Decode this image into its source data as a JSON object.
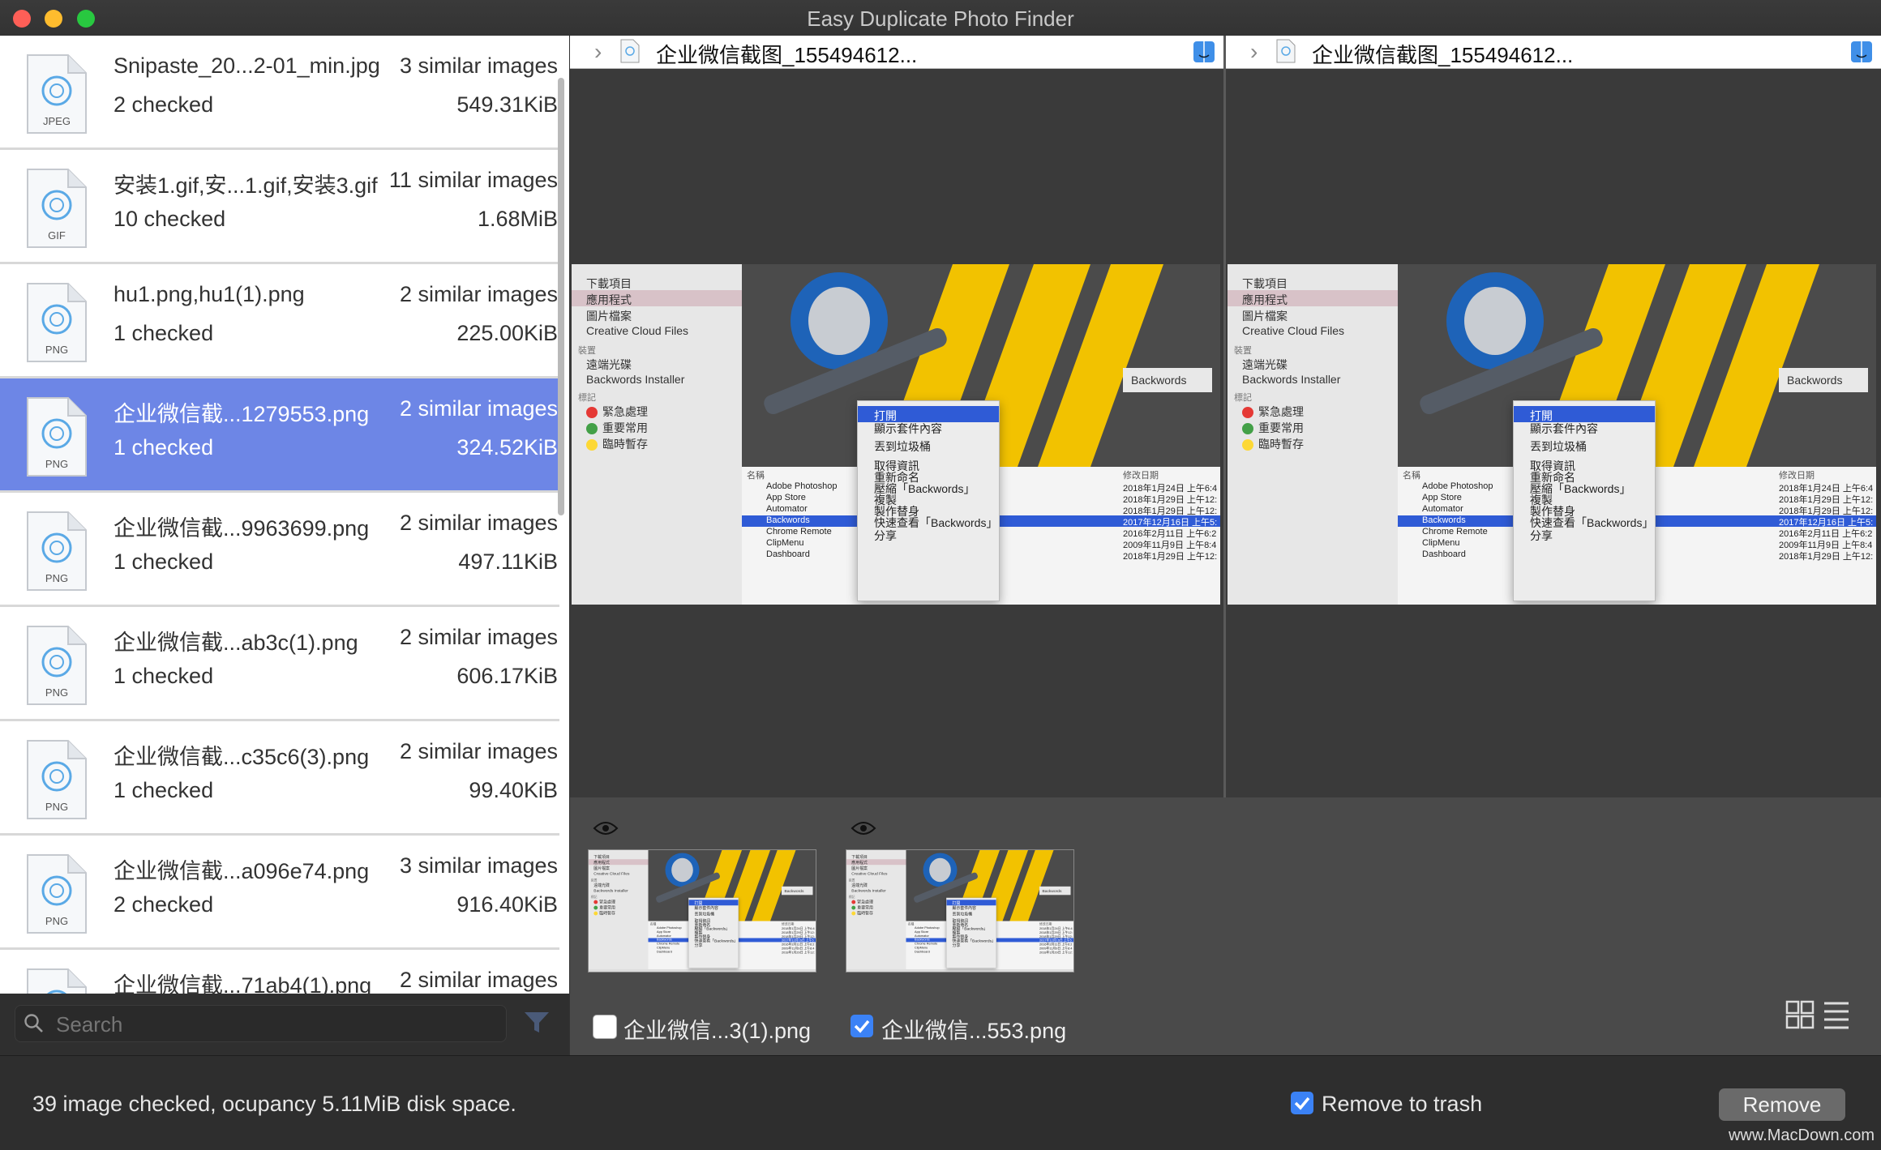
{
  "app": {
    "title": "Easy Duplicate Photo Finder"
  },
  "files": [
    {
      "name": "Snipaste_20...2-01_min.jpg",
      "similar": "3 similar images",
      "checked": "2 checked",
      "size": "549.31KiB",
      "type": "JPEG",
      "selected": false
    },
    {
      "name": "安装1.gif,安...1.gif,安装3.gif",
      "similar": "11 similar images",
      "checked": "10 checked",
      "size": "1.68MiB",
      "type": "GIF",
      "selected": false
    },
    {
      "name": "hu1.png,hu1(1).png",
      "similar": "2 similar images",
      "checked": "1 checked",
      "size": "225.00KiB",
      "type": "PNG",
      "selected": false
    },
    {
      "name": "企业微信截...1279553.png",
      "similar": "2 similar images",
      "checked": "1 checked",
      "size": "324.52KiB",
      "type": "PNG",
      "selected": true
    },
    {
      "name": "企业微信截...9963699.png",
      "similar": "2 similar images",
      "checked": "1 checked",
      "size": "497.11KiB",
      "type": "PNG",
      "selected": false
    },
    {
      "name": "企业微信截...ab3c(1).png",
      "similar": "2 similar images",
      "checked": "1 checked",
      "size": "606.17KiB",
      "type": "PNG",
      "selected": false
    },
    {
      "name": "企业微信截...c35c6(3).png",
      "similar": "2 similar images",
      "checked": "1 checked",
      "size": "99.40KiB",
      "type": "PNG",
      "selected": false
    },
    {
      "name": "企业微信截...a096e74.png",
      "similar": "3 similar images",
      "checked": "2 checked",
      "size": "916.40KiB",
      "type": "PNG",
      "selected": false
    },
    {
      "name": "企业微信截...71ab4(1).png",
      "similar": "2 similar images",
      "checked": "",
      "size": "",
      "type": "PNG",
      "selected": false
    }
  ],
  "search": {
    "placeholder": "Search"
  },
  "panes": [
    {
      "filename": "企业微信截图_155494612..."
    },
    {
      "filename": "企业微信截图_155494612..."
    }
  ],
  "preview": {
    "sidebar": [
      "下載項目",
      "應用程式",
      "圖片檔案",
      "Creative Cloud Files",
      "裝置",
      "遠端光碟",
      "Backwords Installer",
      "標記",
      "緊急處理",
      "重要常用",
      "臨時暫存"
    ],
    "tag_colors": [
      "#e53935",
      "#43a047",
      "#fdd835"
    ],
    "menu": [
      "打開",
      "顯示套件內容",
      "丟到垃圾桶",
      "取得資訊",
      "重新命名",
      "壓縮「Backwords」",
      "複製",
      "製作替身",
      "快速查看「Backwords」",
      "分享"
    ],
    "list_header": "名稱",
    "list": [
      "Adobe Photoshop",
      "App Store",
      "Automator",
      "Backwords",
      "Chrome Remote",
      "ClipMenu",
      "Dashboard"
    ],
    "dates_header": "修改日期",
    "dates": [
      "2018年1月24日 上午6:4",
      "2018年1月29日 上午12:",
      "2018年1月29日 上午12:",
      "2017年12月16日 上午5:",
      "2016年2月11日 上午6:2",
      "2009年11月9日 上午8:4",
      "2018年1月29日 上午12:"
    ],
    "art_label": "Backwords"
  },
  "thumbs": [
    {
      "label": "企业微信...3(1).png",
      "checked": false
    },
    {
      "label": "企业微信...553.png",
      "checked": true
    }
  ],
  "status": {
    "text": "39 image checked, ocupancy 5.11MiB disk space.",
    "trash_label": "Remove to trash",
    "remove_label": "Remove",
    "watermark": "www.MacDown.com"
  }
}
